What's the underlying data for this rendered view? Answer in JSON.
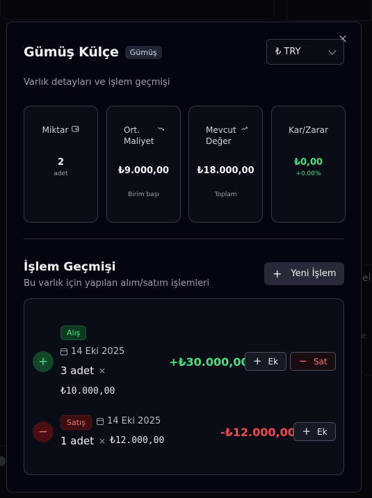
{
  "background": {
    "side_text": "el",
    "side_small": "e"
  },
  "modal": {
    "close_icon": "×",
    "title": "Gümüş Külçe",
    "title_badge": "Gümüş",
    "currency": "₺ TRY",
    "subtitle": "Varlık detayları ve işlem geçmişi"
  },
  "stats": [
    {
      "label": "Miktar",
      "icon": "wallet-icon",
      "value": "2",
      "sub": "adet"
    },
    {
      "label": "Ort. Maliyet",
      "icon": "trend-icon",
      "value": "₺9.000,00",
      "sub": "Birim başı"
    },
    {
      "label": "Mevcut Değer",
      "icon": "trend-icon",
      "value": "₺18.000,00",
      "sub": "Toplam"
    },
    {
      "label": "Kar/Zarar",
      "value": "₺0,00",
      "sub": "+0.00%",
      "color": "#4ade80"
    }
  ],
  "history": {
    "title": "İşlem Geçmişi",
    "subtitle": "Bu varlık için yapılan alım/satım işlemleri",
    "new_button": "Yeni İşlem",
    "transactions": [
      {
        "type": "Alış",
        "date": "14 Eki 2025",
        "quantity": "3 adet",
        "times": "×",
        "unit_price": "₺10.000,00",
        "amount": "+₺30.000,00",
        "add_label": "Ek",
        "sell_label": "Sat"
      },
      {
        "type": "Satış",
        "date": "14 Eki 2025",
        "quantity": "1 adet",
        "times": "×",
        "unit_price": "₺12.000,00",
        "amount": "-₺12.000,00",
        "add_label": "Ek"
      }
    ]
  },
  "colors": {
    "positive": "#4ade80",
    "negative": "#f04a4f",
    "modal_bg": "#030610"
  }
}
